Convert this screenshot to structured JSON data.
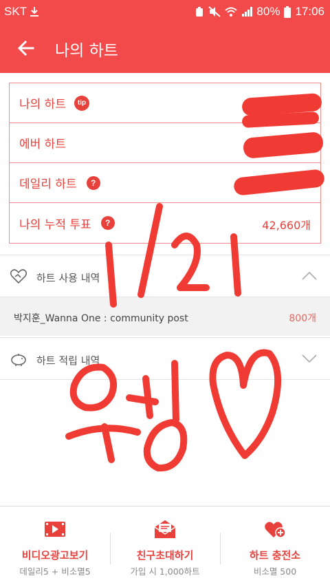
{
  "status_bar": {
    "carrier": "SKT",
    "battery": "80%",
    "time": "17:06"
  },
  "app_bar": {
    "title": "나의 하트"
  },
  "summary": {
    "rows": [
      {
        "label": "나의 하트",
        "badge": "tip",
        "value": ""
      },
      {
        "label": "에버 하트",
        "badge": "",
        "value": ""
      },
      {
        "label": "데일리 하트",
        "badge": "?",
        "value": ""
      },
      {
        "label": "나의 누적 투표",
        "badge": "?",
        "value": "42,660개"
      }
    ]
  },
  "sections": {
    "usage": {
      "label": "하트 사용 내역"
    },
    "earn": {
      "label": "하트 적립 내역"
    }
  },
  "usage_history": [
    {
      "name": "박지훈_Wanna One : community post",
      "amount": "800개"
    }
  ],
  "bottom_actions": [
    {
      "label": "비디오광고보기",
      "sub": "데일리5 + 비소멸5",
      "icon": "video-icon"
    },
    {
      "label": "친구초대하기",
      "sub": "가입 시 1,000하트",
      "icon": "envelope-icon"
    },
    {
      "label": "하트 충전소",
      "sub": "비소멸 500",
      "icon": "heart-plus-icon"
    }
  ],
  "handwriting": "1/21 워너",
  "colors": {
    "primary": "#f24a4a",
    "accent": "#e8403b",
    "ink": "#ef3b33"
  }
}
